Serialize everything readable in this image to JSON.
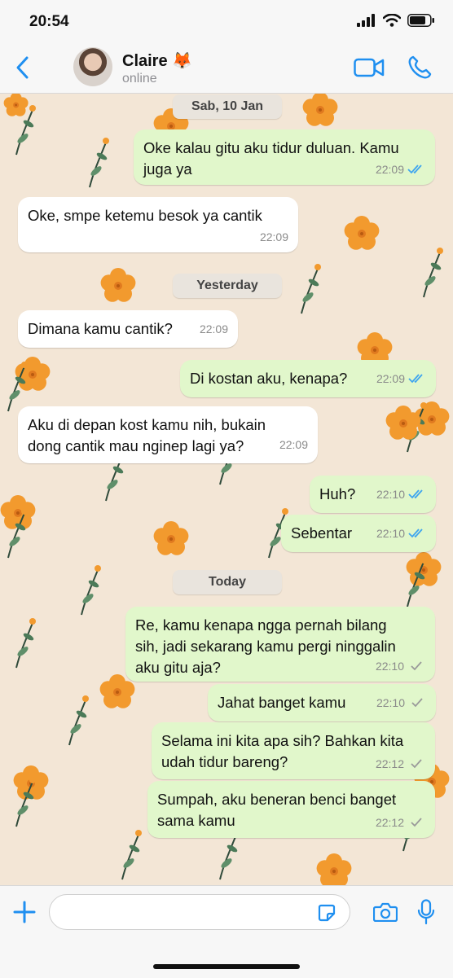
{
  "status_bar": {
    "time": "20:54"
  },
  "header": {
    "contact_name": "Claire 🦊",
    "contact_status": "online"
  },
  "colors": {
    "accent": "#1f8ff0",
    "outgoing_bubble": "#e1f7cb",
    "incoming_bubble": "#ffffff",
    "read_tick": "#3ea5ef"
  },
  "chat": {
    "date_1": "Sab, 10 Jan",
    "date_2": "Yesterday",
    "date_3": "Today",
    "messages": [
      {
        "direction": "out",
        "line1": "Oke kalau gitu aku tidur duluan. Kamu",
        "line2": "juga ya",
        "time": "22:09",
        "status": "read"
      },
      {
        "direction": "in",
        "line1": "Oke, smpe ketemu besok ya cantik",
        "time": "22:09"
      },
      {
        "direction": "in",
        "line1": "Dimana kamu cantik?",
        "time": "22:09"
      },
      {
        "direction": "out",
        "line1": "Di kostan aku, kenapa?",
        "time": "22:09",
        "status": "read"
      },
      {
        "direction": "in",
        "line1": "Aku di depan kost kamu nih, bukain",
        "line2": "dong cantik mau nginep lagi ya?",
        "time": "22:09"
      },
      {
        "direction": "out",
        "line1": "Huh?",
        "time": "22:10",
        "status": "read"
      },
      {
        "direction": "out",
        "line1": "Sebentar",
        "time": "22:10",
        "status": "read"
      },
      {
        "direction": "out",
        "line1": "Re, kamu kenapa ngga pernah bilang",
        "line2": "sih, jadi sekarang kamu pergi ninggalin",
        "line3": "aku gitu aja?",
        "time": "22:10",
        "status": "sent"
      },
      {
        "direction": "out",
        "line1": "Jahat banget kamu",
        "time": "22:10",
        "status": "sent"
      },
      {
        "direction": "out",
        "line1": "Selama ini kita apa sih? Bahkan kita",
        "line2": "udah tidur bareng?",
        "time": "22:12",
        "status": "sent"
      },
      {
        "direction": "out",
        "line1": "Sumpah, aku beneran benci banget",
        "line2": "sama kamu",
        "time": "22:12",
        "status": "sent"
      }
    ]
  },
  "input": {
    "placeholder": ""
  },
  "icons": {
    "back": "chevron-left-icon",
    "video": "video-camera-icon",
    "call": "phone-icon",
    "attach": "plus-icon",
    "sticker": "sticker-icon",
    "camera": "camera-icon",
    "mic": "microphone-icon"
  }
}
